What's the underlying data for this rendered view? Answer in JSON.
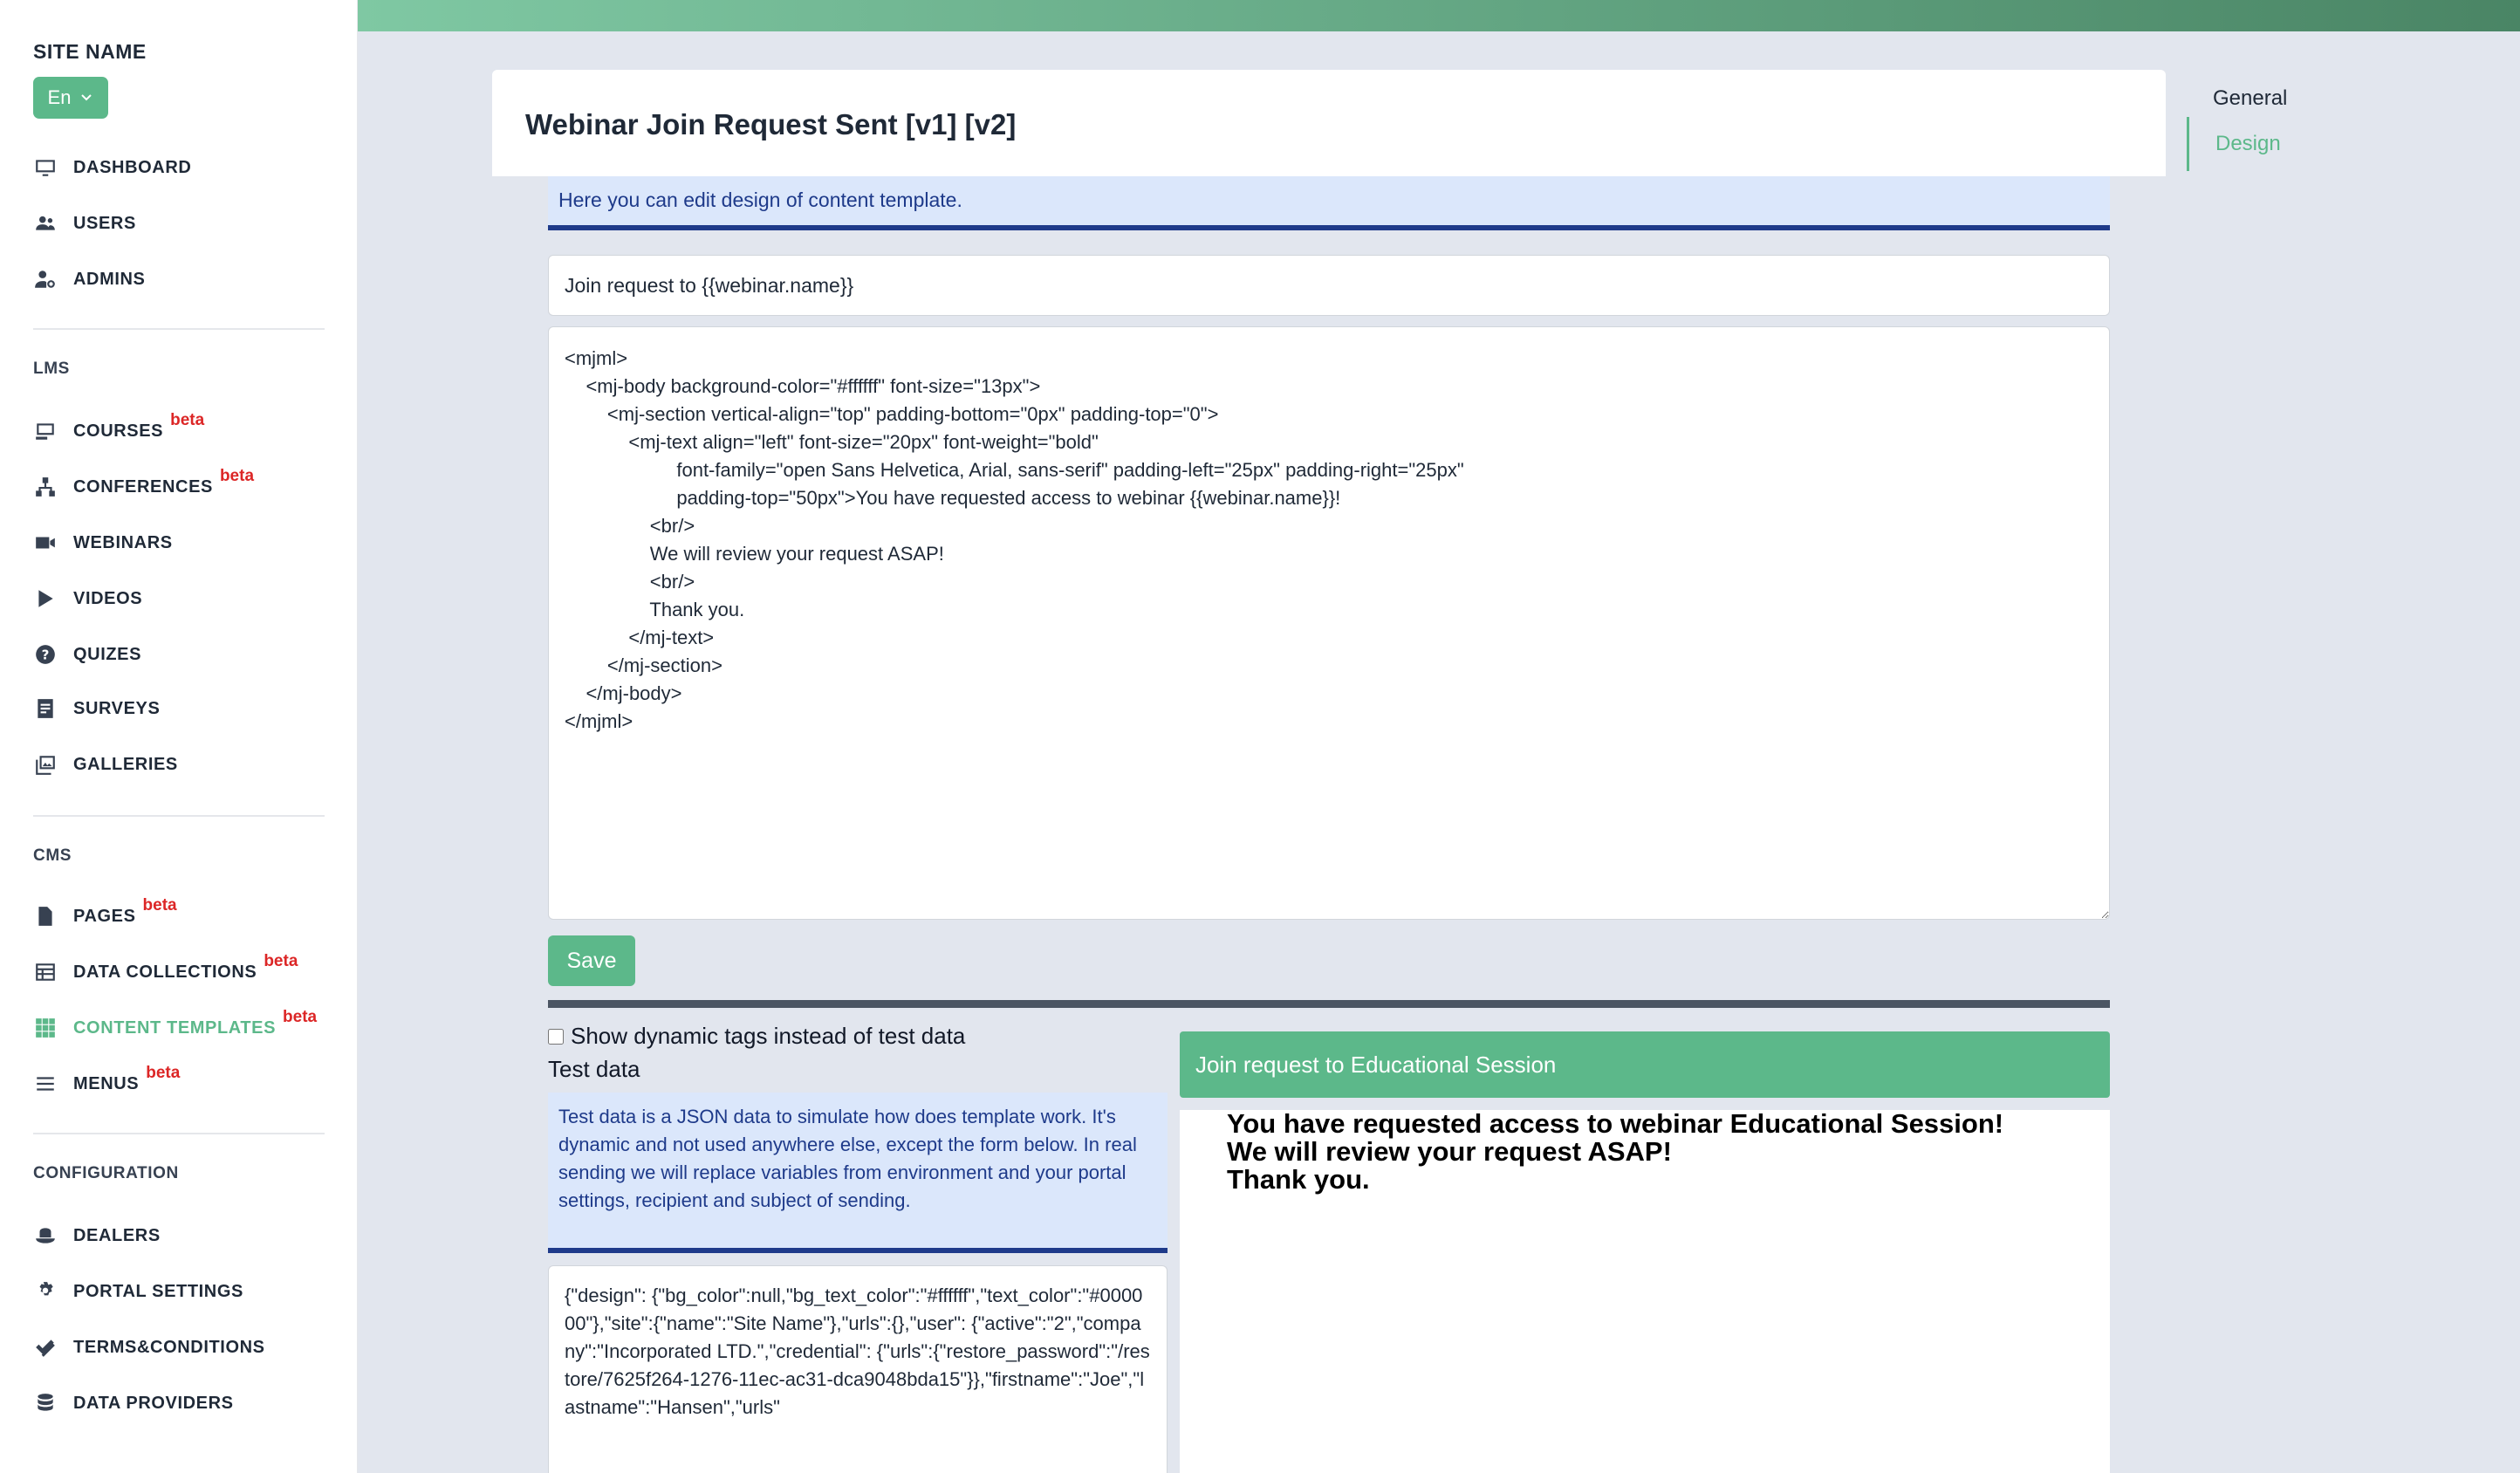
{
  "sidebar": {
    "site_name": "SITE NAME",
    "language": "En",
    "top_items": [
      {
        "label": "DASHBOARD",
        "icon": "monitor-icon"
      },
      {
        "label": "USERS",
        "icon": "users-icon"
      },
      {
        "label": "ADMINS",
        "icon": "admin-icon"
      }
    ],
    "sections": {
      "lms": "LMS",
      "cms": "CMS",
      "configuration": "CONFIGURATION"
    },
    "lms_items": [
      {
        "label": "COURSES",
        "beta": "beta"
      },
      {
        "label": "CONFERENCES",
        "beta": "beta"
      },
      {
        "label": "WEBINARS",
        "beta": ""
      },
      {
        "label": "VIDEOS",
        "beta": ""
      },
      {
        "label": "QUIZES",
        "beta": ""
      },
      {
        "label": "SURVEYS",
        "beta": ""
      },
      {
        "label": "GALLERIES",
        "beta": ""
      }
    ],
    "cms_items": [
      {
        "label": "PAGES",
        "beta": "beta"
      },
      {
        "label": "DATA COLLECTIONS",
        "beta": "beta"
      },
      {
        "label": "CONTENT TEMPLATES",
        "beta": "beta"
      },
      {
        "label": "MENUS",
        "beta": "beta"
      }
    ],
    "config_items": [
      {
        "label": "DEALERS"
      },
      {
        "label": "PORTAL SETTINGS"
      },
      {
        "label": "TERMS&CONDITIONS"
      },
      {
        "label": "DATA PROVIDERS"
      }
    ],
    "active_color": "#5cb88a"
  },
  "page": {
    "title": "Webinar Join Request Sent [v1] [v2]",
    "info": "Here you can edit design of content template.",
    "subject": "Join request to {{webinar.name}}",
    "code": "<mjml>\n    <mj-body background-color=\"#ffffff\" font-size=\"13px\">\n        <mj-section vertical-align=\"top\" padding-bottom=\"0px\" padding-top=\"0\">\n            <mj-text align=\"left\" font-size=\"20px\" font-weight=\"bold\"\n                     font-family=\"open Sans Helvetica, Arial, sans-serif\" padding-left=\"25px\" padding-right=\"25px\"\n                     padding-top=\"50px\">You have requested access to webinar {{webinar.name}}!\n                <br/>\n                We will review your request ASAP!\n                <br/>\n                Thank you.\n            </mj-text>\n        </mj-section>\n    </mj-body>\n</mjml>",
    "save_label": "Save",
    "show_dynamic_label": "Show dynamic tags instead of test data",
    "test_data_label": "Test data",
    "test_data_info": "Test data is a JSON data to simulate how does template work. It's dynamic and not used anywhere else, except the form below. In real sending we will replace variables from environment and your portal settings, recipient and subject of sending.",
    "json_text": "{\"design\":\n{\"bg_color\":null,\"bg_text_color\":\"#ffffff\",\"text_color\":\"#000000\"},\"site\":{\"name\":\"Site Name\"},\"urls\":{},\"user\":\n{\"active\":\"2\",\"company\":\"Incorporated LTD.\",\"credential\":\n{\"urls\":{\"restore_password\":\"/restore/7625f264-1276-11ec-ac31-dca9048bda15\"}},\"firstname\":\"Joe\",\"lastname\":\"Hansen\",\"urls\"",
    "preview_subject": "Join request to Educational Session",
    "preview_lines": [
      "You have requested access to webinar Educational Session!",
      "We will review your request ASAP!",
      "Thank you."
    ]
  },
  "right_nav": {
    "general": "General",
    "design": "Design"
  }
}
